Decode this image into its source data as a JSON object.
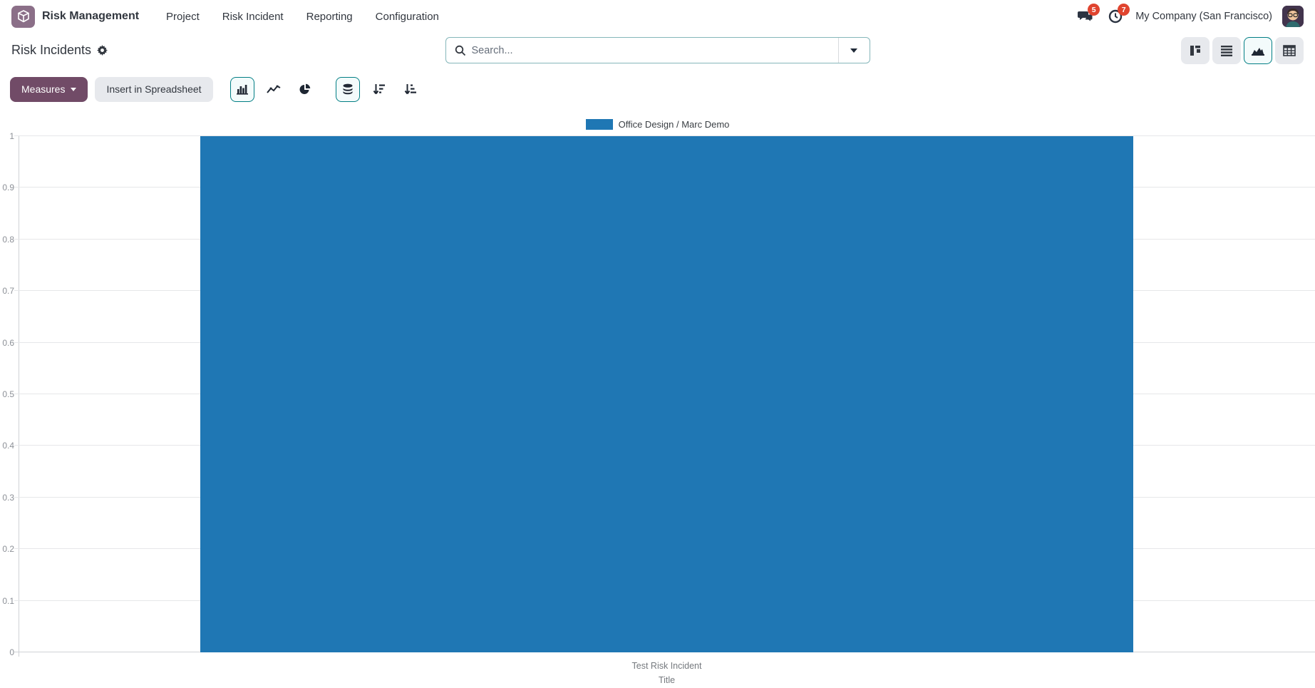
{
  "navbar": {
    "app_name": "Risk Management",
    "menu_items": [
      {
        "label": "Project"
      },
      {
        "label": "Risk Incident"
      },
      {
        "label": "Reporting"
      },
      {
        "label": "Configuration"
      }
    ],
    "messages_badge": "5",
    "activities_badge": "7",
    "company": "My Company (San Francisco)"
  },
  "header": {
    "title": "Risk Incidents",
    "search": {
      "placeholder": "Search..."
    }
  },
  "toolbar": {
    "measures_label": "Measures",
    "insert_label": "Insert in Spreadsheet"
  },
  "colors": {
    "accent_purple": "#714B67",
    "accent_teal": "#017e84",
    "badge_red": "#e0442f",
    "bar_blue": "#1f77b4"
  },
  "chart_data": {
    "type": "bar",
    "title": "",
    "categories": [
      "Test Risk Incident"
    ],
    "series": [
      {
        "name": "Office Design / Marc Demo",
        "values": [
          1
        ],
        "color": "#1f77b4"
      }
    ],
    "xlabel": "Title",
    "ylabel": "",
    "ylim": [
      0,
      1
    ],
    "ytick_step": 0.1,
    "grid": true,
    "legend_position": "top-center",
    "stacked": true,
    "bar_width_pct": 72
  }
}
